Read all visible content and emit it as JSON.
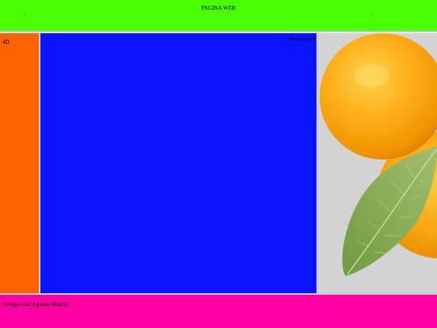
{
  "header": {
    "title": "PAGINA WEB"
  },
  "sidebar": {
    "label": "4D"
  },
  "main": {
    "link_text": "Ver Clase 4D"
  },
  "aside": {
    "image": "oranges-with-leaf"
  },
  "footer": {
    "text": "Colegio San Agustin Madrid"
  },
  "colors": {
    "header_bg": "#4cff00",
    "sidebar_bg": "#ff6200",
    "main_bg": "#0a14ff",
    "aside_bg": "#d3d3d3",
    "footer_bg": "#ff00a0"
  }
}
